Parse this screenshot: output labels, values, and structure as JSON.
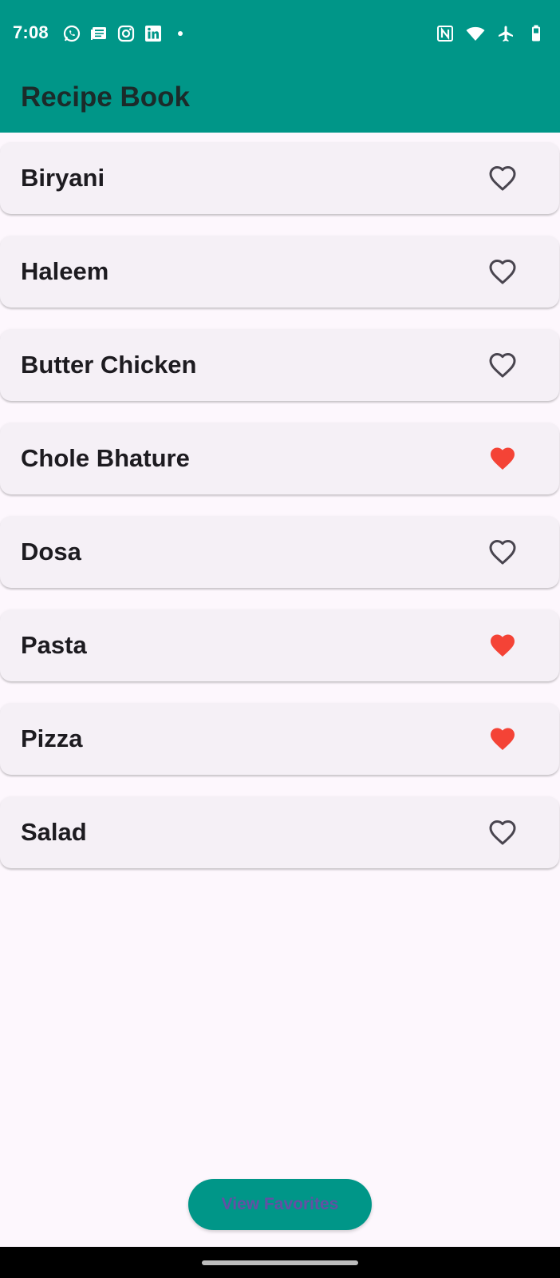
{
  "status_bar": {
    "time": "7:08",
    "left_icons": [
      "whatsapp-icon",
      "news-icon",
      "instagram-icon",
      "linkedin-icon",
      "notification-dot-icon"
    ],
    "right_icons": [
      "nfc-icon",
      "wifi-icon",
      "airplane-mode-icon",
      "battery-icon"
    ]
  },
  "app_bar": {
    "title": "Recipe Book"
  },
  "recipes": [
    {
      "name": "Biryani",
      "favorite": false
    },
    {
      "name": "Haleem",
      "favorite": false
    },
    {
      "name": "Butter Chicken",
      "favorite": false
    },
    {
      "name": "Chole Bhature",
      "favorite": true
    },
    {
      "name": "Dosa",
      "favorite": false
    },
    {
      "name": "Pasta",
      "favorite": true
    },
    {
      "name": "Pizza",
      "favorite": true
    },
    {
      "name": "Salad",
      "favorite": false
    }
  ],
  "fab": {
    "label": "View Favorites"
  },
  "colors": {
    "primary": "#009688",
    "background": "#FDF7FD",
    "card": "#F5F0F6",
    "favorite_filled": "#F44336",
    "favorite_outline": "#49454F",
    "fab_text": "#6450A4"
  }
}
